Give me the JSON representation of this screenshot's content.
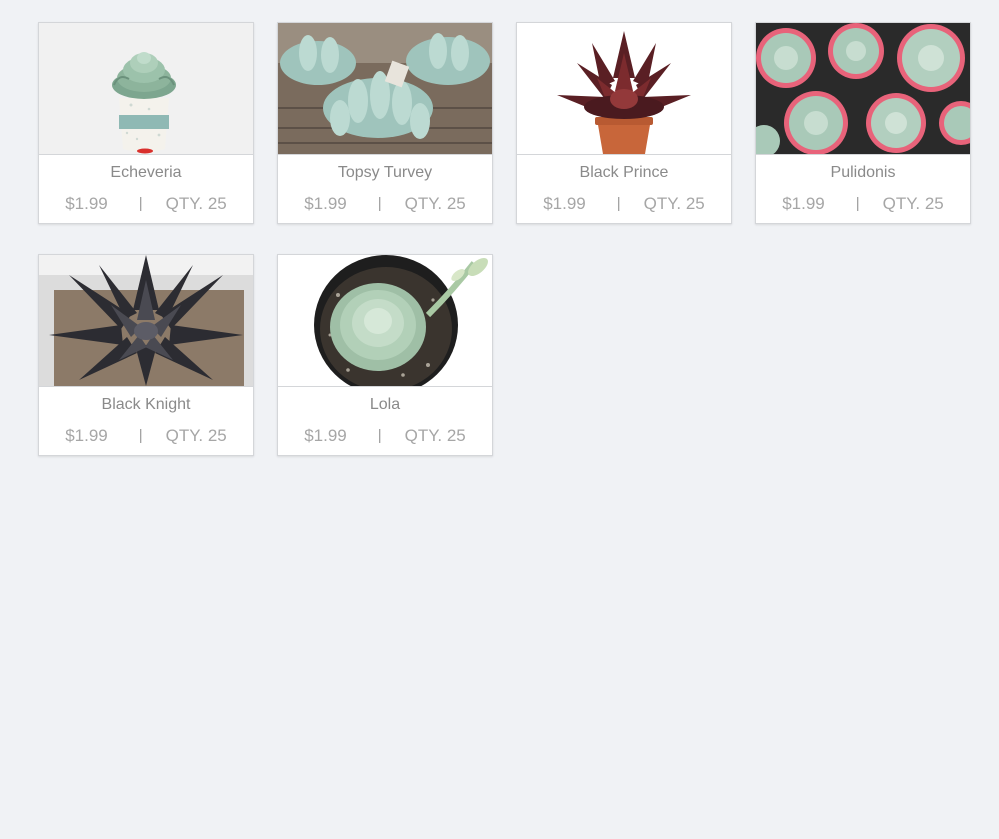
{
  "products": [
    {
      "name": "Echeveria",
      "price": "$1.99",
      "separator": "|",
      "qty": "QTY. 25",
      "image": "echeveria-in-striped-pot"
    },
    {
      "name": "Topsy Turvey",
      "price": "$1.99",
      "separator": "|",
      "qty": "QTY. 25",
      "image": "topsy-turvy-succulents-on-wood"
    },
    {
      "name": "Black Prince",
      "price": "$1.99",
      "separator": "|",
      "qty": "QTY. 25",
      "image": "black-prince-in-terracotta-pot"
    },
    {
      "name": "Pulidonis",
      "price": "$1.99",
      "separator": "|",
      "qty": "QTY. 25",
      "image": "pulidonis-rosettes-cluster"
    },
    {
      "name": "Black Knight",
      "price": "$1.99",
      "separator": "|",
      "qty": "QTY. 25",
      "image": "black-knight-rosette"
    },
    {
      "name": "Lola",
      "price": "$1.99",
      "separator": "|",
      "qty": "QTY. 25",
      "image": "lola-in-black-pot"
    }
  ],
  "colors": {
    "page_background": "#f0f2f5",
    "card_background": "#ffffff",
    "card_border": "#d4d6d9",
    "name_text": "#8a8a8a",
    "meta_text": "#a6a6a6"
  }
}
